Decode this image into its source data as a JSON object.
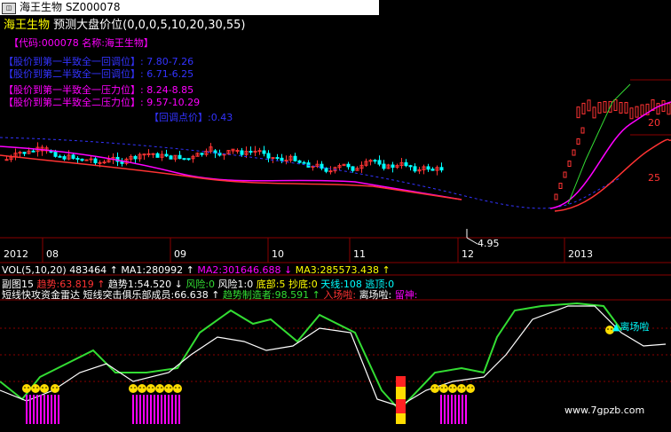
{
  "window": {
    "app_icon": "app-icon",
    "title": "海王生物 SZ000078"
  },
  "header": {
    "name": "海王生物",
    "formula": "预测大盘价位(0,0,0,5,10,20,30,55)"
  },
  "code_line": "【代码:000078 名称:海王生物】",
  "annotations": [
    {
      "label": "【股价到第一半致全一回调位】:",
      "value": "7.80-7.26",
      "color": "#3333ff"
    },
    {
      "label": "【股价到第二半致全一回调位】:",
      "value": "6.71-6.25",
      "color": "#3333ff"
    },
    {
      "label": "【股价到第一半致全一压力位】:",
      "value": "8.24-8.85",
      "color": "#ff00ff"
    },
    {
      "label": "【股价到第二半致全二压力位】:",
      "value": "9.57-10.29",
      "color": "#ff00ff"
    }
  ],
  "pivot": {
    "label": "【回调点价】:",
    "value": "0.43"
  },
  "price_low_label": "4.95",
  "y_labels": [
    "20",
    "25"
  ],
  "dates": [
    "2012",
    "08",
    "09",
    "10",
    "11",
    "12",
    "2013"
  ],
  "volume": {
    "label": "VOL(5,10,20)",
    "vol": "483464 ↑",
    "ma1": "MA1:280992 ↑",
    "ma2": "MA2:301646.688 ↓",
    "ma3": "MA3:285573.438 ↑"
  },
  "indicator_line": {
    "a": "短线快攻资金雷达",
    "b": "短线突击俱乐部成员:66.638 ↑",
    "c": "趋势制造者:98.591 ↑",
    "d": "入场啦:",
    "e": "离场啦:",
    "f": "留神:"
  },
  "sub_line": {
    "name": "副图15",
    "t1": "趋势:63.819 ↑",
    "t2": "趋势1:54.520 ↓",
    "r1": "风险:0",
    "r2": "风险1:0",
    "b": "底部:5",
    "c": "抄底:0",
    "tx": "天线:108",
    "ty": "逃顶:0"
  },
  "exit_label": "离场啦",
  "watermark": "www.7gpzb.com",
  "chart_data": {
    "type": "candlestick+indicator",
    "x_ticks": [
      "2012",
      "08",
      "09",
      "10",
      "11",
      "12",
      "2013"
    ],
    "price_annotations": [
      "4.95"
    ],
    "y_ticks_visible": [
      "20",
      "25"
    ]
  },
  "colors": {
    "up": "#ff3333",
    "down": "#00ffff",
    "ma": "#ff00ff",
    "green": "#33dd33",
    "white": "#ffffff"
  }
}
